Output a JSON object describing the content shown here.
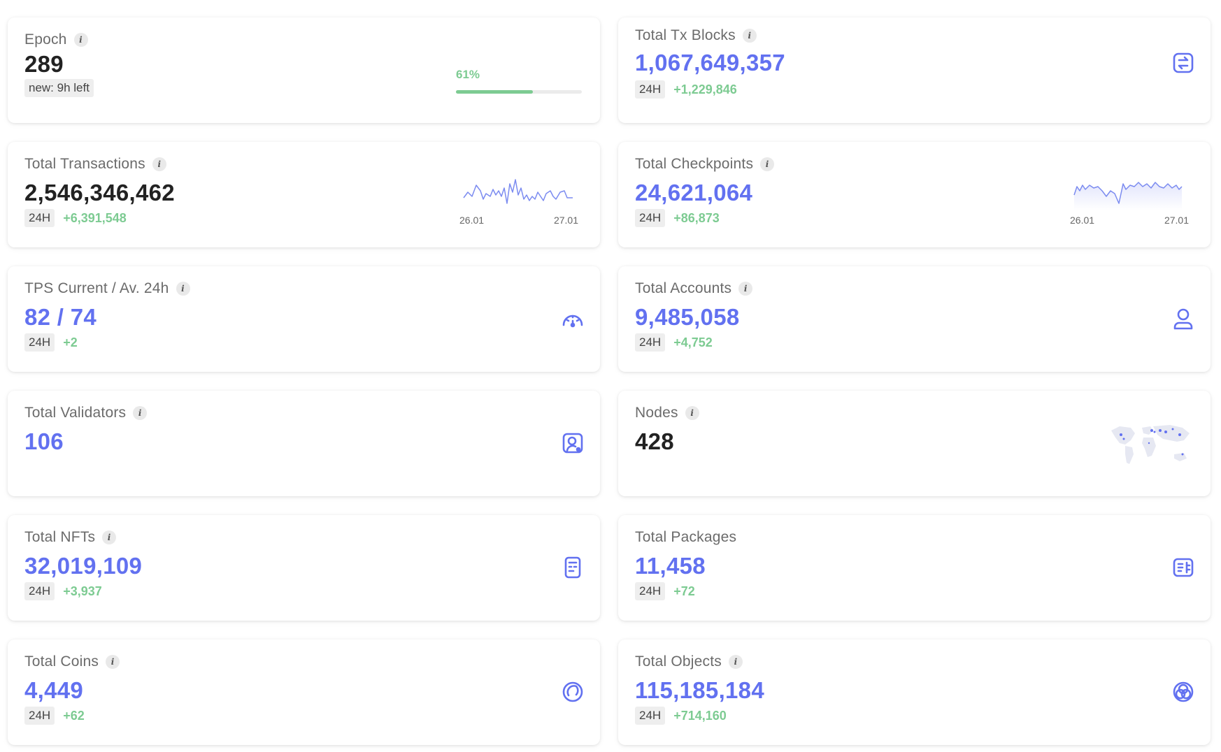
{
  "epoch": {
    "title": "Epoch",
    "value": "289",
    "sub": "new: 9h left",
    "progress_label": "61%",
    "progress": 0.61
  },
  "tx_blocks": {
    "title": "Total Tx Blocks",
    "value": "1,067,649,357",
    "period": "24H",
    "delta": "+1,229,846",
    "icon": "transfer-icon"
  },
  "transactions": {
    "title": "Total Transactions",
    "value": "2,546,346,462",
    "period": "24H",
    "delta": "+6,391,548",
    "chart": {
      "x_start": "26.01",
      "x_end": "27.01"
    }
  },
  "checkpoints": {
    "title": "Total Checkpoints",
    "value": "24,621,064",
    "period": "24H",
    "delta": "+86,873",
    "chart": {
      "x_start": "26.01",
      "x_end": "27.01"
    }
  },
  "tps": {
    "title": "TPS Current / Av. 24h",
    "value": "82 / 74",
    "period": "24H",
    "delta": "+2",
    "icon": "speedometer-icon"
  },
  "accounts": {
    "title": "Total Accounts",
    "value": "9,485,058",
    "period": "24H",
    "delta": "+4,752",
    "icon": "user-icon"
  },
  "validators": {
    "title": "Total Validators",
    "value": "106",
    "icon": "validator-icon"
  },
  "nodes": {
    "title": "Nodes",
    "value": "428",
    "icon": "world-map-icon"
  },
  "nfts": {
    "title": "Total NFTs",
    "value": "32,019,109",
    "period": "24H",
    "delta": "+3,937",
    "icon": "nft-icon"
  },
  "packages": {
    "title": "Total Packages",
    "value": "11,458",
    "period": "24H",
    "delta": "+72",
    "icon": "package-icon"
  },
  "coins": {
    "title": "Total Coins",
    "value": "4,449",
    "period": "24H",
    "delta": "+62",
    "icon": "coin-icon"
  },
  "objects": {
    "title": "Total Objects",
    "value": "115,185,184",
    "period": "24H",
    "delta": "+714,160",
    "icon": "objects-icon"
  },
  "colors": {
    "accent": "#6271f0",
    "positive": "#7dcb92",
    "dark": "#222222"
  }
}
